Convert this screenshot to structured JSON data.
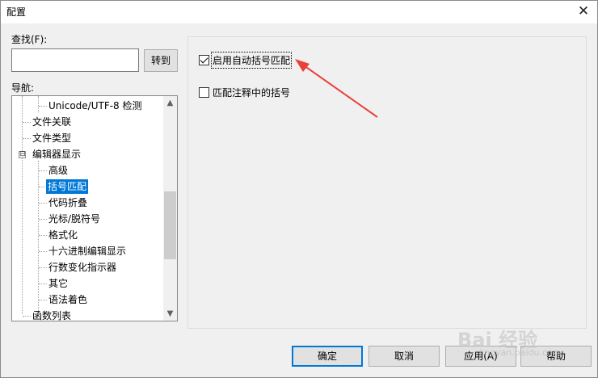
{
  "window": {
    "title": "配置",
    "close_glyph": "✕"
  },
  "find": {
    "label": "查找(F):",
    "value": "",
    "goto_label": "转到"
  },
  "nav": {
    "label": "导航:",
    "items": [
      {
        "label": "Unicode/UTF-8 检测"
      },
      {
        "label": "文件关联"
      },
      {
        "label": "文件类型"
      },
      {
        "label": "编辑器显示",
        "expander": "⊟"
      },
      {
        "label": "高级"
      },
      {
        "label": "括号匹配"
      },
      {
        "label": "代码折叠"
      },
      {
        "label": "光标/脱符号"
      },
      {
        "label": "格式化"
      },
      {
        "label": "十六进制编辑显示"
      },
      {
        "label": "行数变化指示器"
      },
      {
        "label": "其它"
      },
      {
        "label": "语法着色"
      },
      {
        "label": "函数列表"
      }
    ],
    "scroll_up": "▲",
    "scroll_down": "▼"
  },
  "options": {
    "enable_brace_matching": {
      "label": "启用自动括号匹配",
      "checked": true
    },
    "match_in_comments": {
      "label": "匹配注释中的括号",
      "checked": false
    }
  },
  "buttons": {
    "ok": "确定",
    "cancel": "取消",
    "apply": "应用(A)",
    "help": "帮助"
  },
  "watermark": {
    "text": "Bai 经验",
    "sub": "jingyan.baidu.com"
  },
  "colors": {
    "annotation_arrow": "#e8413b",
    "selection": "#0078d7"
  }
}
